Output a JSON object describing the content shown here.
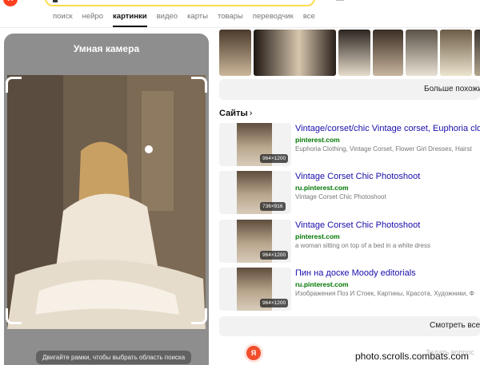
{
  "header": {
    "logo_letter": "Я",
    "nav_tabs": [
      {
        "label": "поиск"
      },
      {
        "label": "нейро"
      },
      {
        "label": "картинки",
        "active": true
      },
      {
        "label": "видео"
      },
      {
        "label": "карты"
      },
      {
        "label": "товары"
      },
      {
        "label": "переводчик"
      },
      {
        "label": "все"
      }
    ]
  },
  "camera": {
    "title": "Умная камера",
    "photo_watermark": "photo.scrolls.combats.com",
    "hint": "Двигайте рамки, чтобы выбрать область поиска"
  },
  "similar": {
    "more_label": "Больше похожи"
  },
  "sites": {
    "title": "Сайты",
    "results": [
      {
        "title": "Vintage/corset/chic Vintage corset, Euphoria clot",
        "domain": "pinterest.com",
        "desc": "Euphoria Clothing, Vintage Corset, Flower Girl Dresses, Hairst",
        "size": "964×1200"
      },
      {
        "title": "Vintage Corset Chic Photoshoot",
        "domain": "ru.pinterest.com",
        "desc": "Vintage Corset Chic Photoshoot",
        "size": "736×916"
      },
      {
        "title": "Vintage Corset Chic Photoshoot",
        "domain": "pinterest.com",
        "desc": "a woman sitting on top of a bed in a white dress",
        "size": "964×1200"
      },
      {
        "title": "Пин на доске Moody editorials",
        "domain": "ru.pinterest.com",
        "desc": "Изображения Поз И Стоек, Картины, Красота, Художники, Ф",
        "size": "964×1200"
      }
    ],
    "see_all_label": "Смотреть все"
  },
  "footer": {
    "alice_letter": "Я",
    "ask_label": "Задать вопрос",
    "watermark": "photo.scrolls.combats.com"
  },
  "colors": {
    "brand": "#fc3f1d",
    "link": "#1a0dab",
    "domain": "#007700",
    "search_border": "#ffdb4d"
  }
}
